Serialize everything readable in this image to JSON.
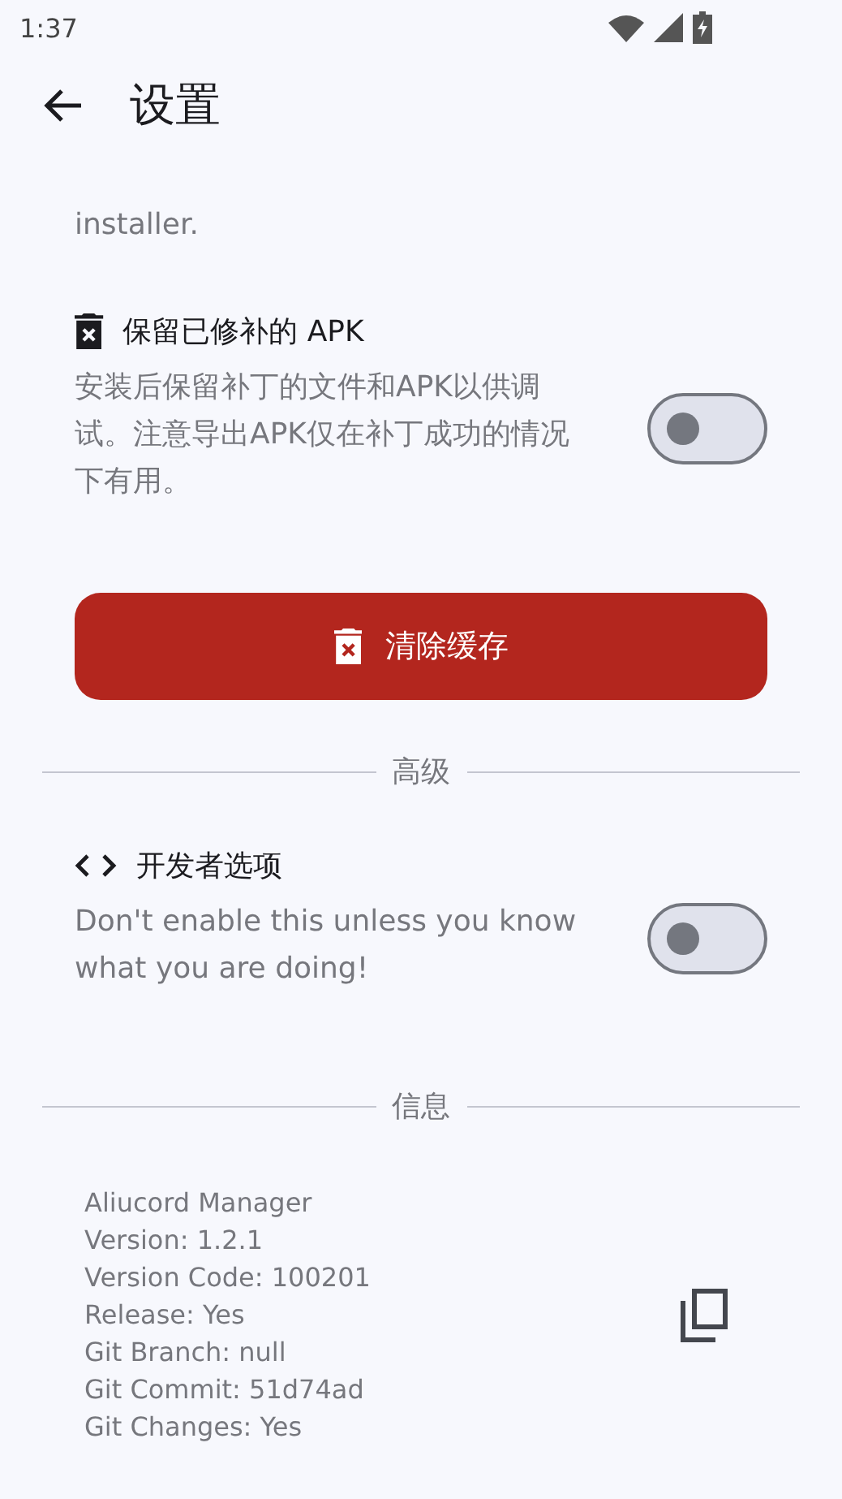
{
  "status_bar": {
    "time": "1:37"
  },
  "app_bar": {
    "title": "设置"
  },
  "items": [
    {
      "kind": "text",
      "text": "installer."
    },
    {
      "kind": "toggle",
      "title": "保留已修补的 APK",
      "description": "安装后保留补丁的文件和APK以供调试。注意导出APK仅在补丁成功的情况下有用。",
      "on": false
    },
    {
      "kind": "button",
      "label": "清除缓存"
    },
    {
      "kind": "divider",
      "label": "高级"
    },
    {
      "kind": "toggle",
      "title": "开发者选项",
      "description": "Don't enable this unless you know what you are doing!",
      "on": false
    },
    {
      "kind": "divider",
      "label": "信息"
    },
    {
      "kind": "info",
      "lines": [
        "Aliucord Manager",
        "Version: 1.2.1",
        "Version Code: 100201",
        "Release: Yes",
        "Git Branch: null",
        "Git Commit: 51d74ad",
        "Git Changes: Yes"
      ]
    }
  ]
}
